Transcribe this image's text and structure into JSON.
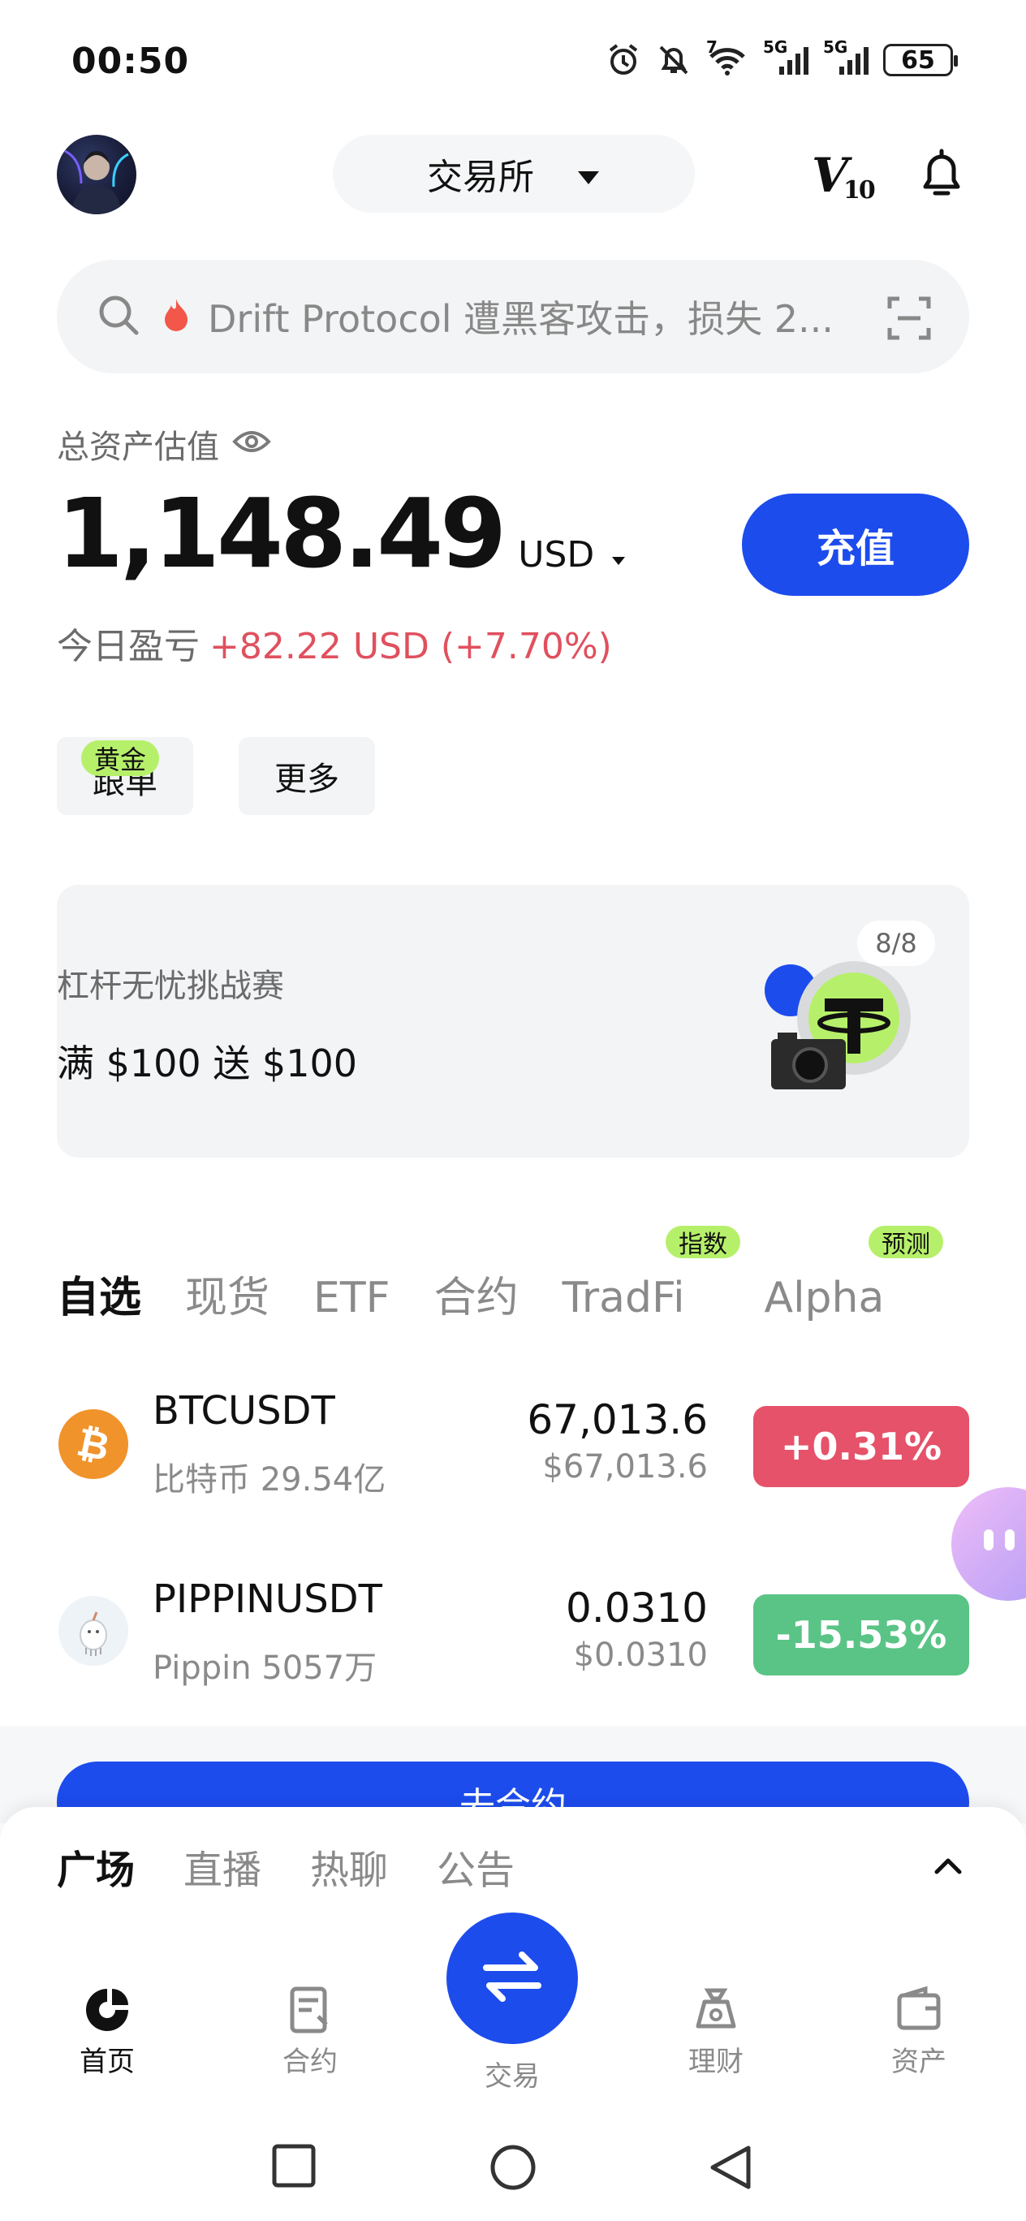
{
  "status_bar": {
    "time": "00:50",
    "network_label": "5G",
    "wifi_label": "7",
    "battery": "65"
  },
  "header": {
    "exchange_label": "交易所",
    "vip_label": "V",
    "vip_level": "10"
  },
  "search": {
    "text": "Drift Protocol 遭黑客攻击，损失 2..."
  },
  "assets": {
    "label": "总资产估值",
    "amount": "1,148.49",
    "currency": "USD",
    "deposit_label": "充值",
    "pnl_label": "今日盈亏",
    "pnl_value": "+82.22 USD (+7.70%)"
  },
  "shortcuts": {
    "copy_trade": "跟单",
    "copy_trade_badge": "黄金",
    "more": "更多"
  },
  "banner": {
    "subtitle": "杠杆无忧挑战赛",
    "title": "满 $100 送 $100",
    "counter": "8/8"
  },
  "market_tabs": [
    {
      "label": "自选"
    },
    {
      "label": "现货"
    },
    {
      "label": "ETF"
    },
    {
      "label": "合约"
    },
    {
      "label": "TradFi",
      "badge": "指数"
    },
    {
      "label": "Alpha",
      "badge": "预测"
    }
  ],
  "rows": [
    {
      "symbol": "BTCUSDT",
      "sub": "比特币 29.54亿",
      "price": "67,013.6",
      "price_usd": "$67,013.6",
      "change": "+0.31%",
      "color": "#e5526a"
    },
    {
      "symbol": "PIPPINUSDT",
      "sub": "Pippin 5057万",
      "price": "0.0310",
      "price_usd": "$0.0310",
      "change": "-15.53%",
      "color": "#5ac486"
    }
  ],
  "futures_button": "去合约",
  "feed_tabs": [
    "广场",
    "直播",
    "热聊",
    "公告"
  ],
  "bottom_nav": {
    "home": "首页",
    "futures": "合约",
    "trade": "交易",
    "earn": "理财",
    "assets": "资产"
  },
  "colors": {
    "accent": "#1d4ced",
    "up": "#e5526a",
    "down": "#5ac486",
    "badge": "#b6f06a"
  }
}
